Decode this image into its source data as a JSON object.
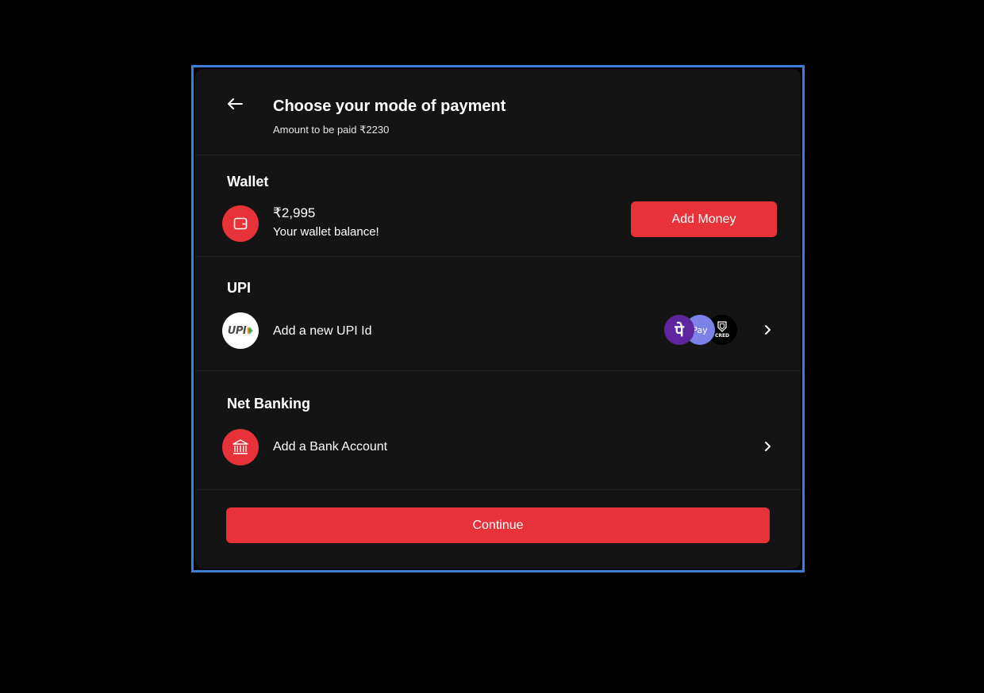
{
  "header": {
    "title": "Choose your mode of payment",
    "subtitle": "Amount to be paid ₹2230"
  },
  "wallet": {
    "title": "Wallet",
    "balance": "₹2,995",
    "balance_caption": "Your wallet balance!",
    "add_money_label": "Add Money"
  },
  "upi": {
    "title": "UPI",
    "upi_logo_text": "UPI",
    "row_label": "Add a new UPI Id",
    "apps": [
      {
        "name": "PhonePe",
        "glyph": "पे",
        "color": "#5f259f"
      },
      {
        "name": "GPay",
        "glyph": "Pay",
        "color": "#7b82e8"
      },
      {
        "name": "CRED",
        "glyph": "CRED",
        "color": "#000000"
      }
    ]
  },
  "net_banking": {
    "title": "Net Banking",
    "row_label": "Add a Bank Account"
  },
  "footer": {
    "continue_label": "Continue"
  },
  "colors": {
    "accent": "#e8323a",
    "background": "#141414",
    "frame": "#3a7fd6"
  }
}
